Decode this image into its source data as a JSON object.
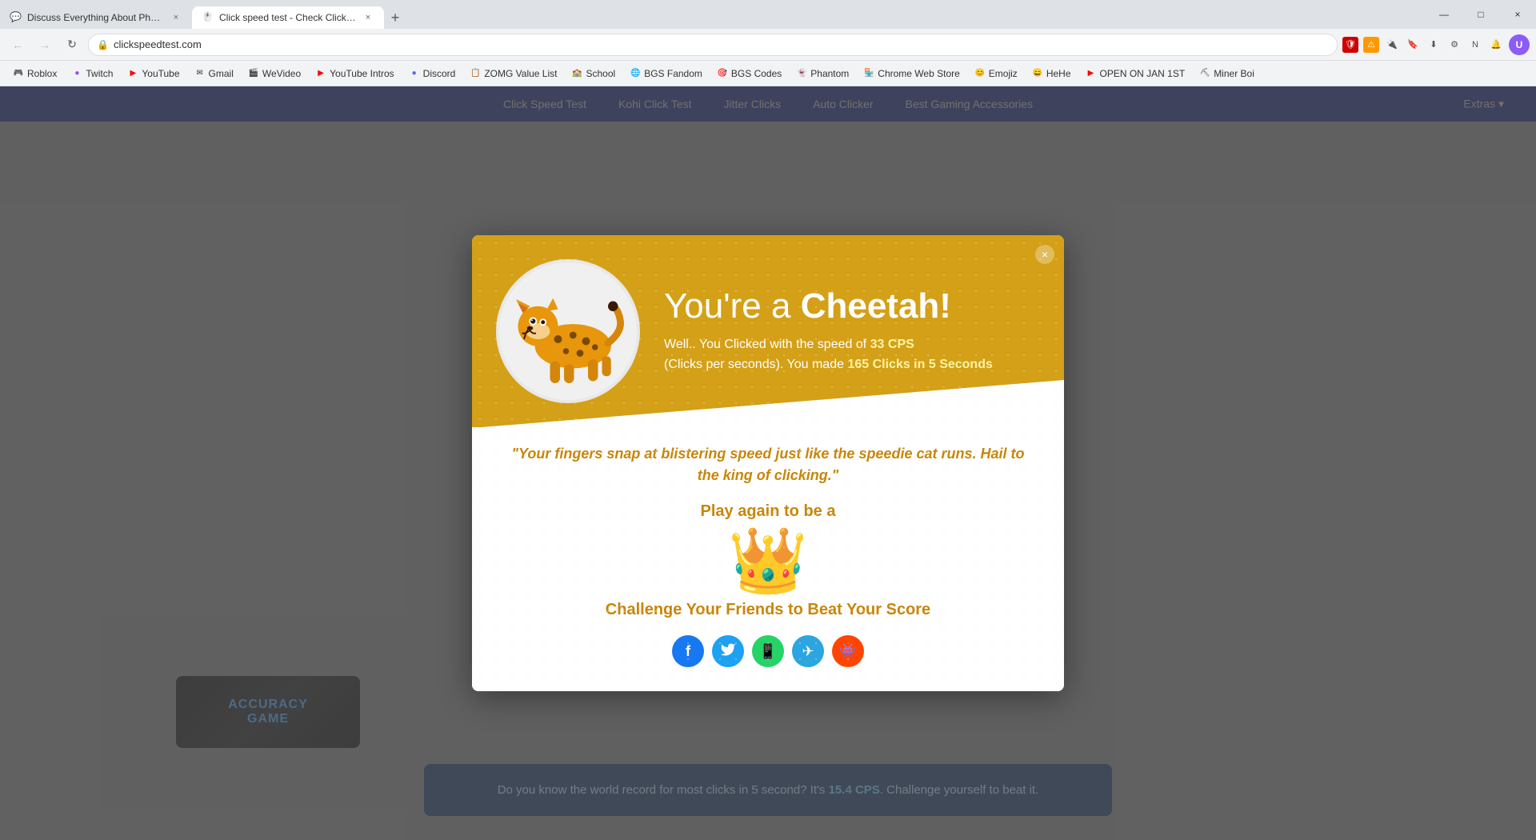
{
  "browser": {
    "tabs": [
      {
        "id": "tab-1",
        "title": "Discuss Everything About Phanto...",
        "favicon": "💬",
        "active": false
      },
      {
        "id": "tab-2",
        "title": "Click speed test - Check Clicks pe...",
        "favicon": "🖱️",
        "active": true
      }
    ],
    "url": "clickspeedtest.com",
    "new_tab_label": "+",
    "window_controls": {
      "minimize": "—",
      "maximize": "□",
      "close": "×"
    }
  },
  "bookmarks": [
    {
      "label": "Roblox",
      "favicon": "🎮"
    },
    {
      "label": "Twitch",
      "favicon": "💜"
    },
    {
      "label": "YouTube",
      "favicon": "▶"
    },
    {
      "label": "Gmail",
      "favicon": "✉"
    },
    {
      "label": "WeVideo",
      "favicon": "🎬"
    },
    {
      "label": "YouTube Intros",
      "favicon": "▶"
    },
    {
      "label": "Discord",
      "favicon": "💬"
    },
    {
      "label": "ZOMG Value List",
      "favicon": "📋"
    },
    {
      "label": "School",
      "favicon": "🏫"
    },
    {
      "label": "BGS Fandom",
      "favicon": "🌐"
    },
    {
      "label": "BGS Codes",
      "favicon": "🎯"
    },
    {
      "label": "Phantom",
      "favicon": "👻"
    },
    {
      "label": "Chrome Web Store",
      "favicon": "🏪"
    },
    {
      "label": "Emojiz",
      "favicon": "😊"
    },
    {
      "label": "HeHe",
      "favicon": "😄"
    },
    {
      "label": "OPEN ON JAN 1ST",
      "favicon": "📅"
    },
    {
      "label": "Miner Boi",
      "favicon": "⛏"
    }
  ],
  "site_nav": {
    "items": [
      "Click Speed Test",
      "Kohi Click Test",
      "Jitter Clicks",
      "Auto Clicker",
      "Best Gaming Accessories"
    ],
    "extras_label": "Extras ▾"
  },
  "modal": {
    "close_btn": "×",
    "animal": "Cheetah",
    "title": "You're a",
    "title_bold": "Cheetah!",
    "subtitle_prefix": "Well.. You Clicked with the speed of ",
    "cps": "33 CPS",
    "subtitle_suffix": "(Clicks per seconds). You made ",
    "clicks_highlight": "165 Clicks in 5 Seconds",
    "quote": "\"Your fingers snap at blistering speed just like the speedie cat runs. Hail to the king of clicking.\"",
    "play_again_text": "Play again to be a",
    "crown_emoji": "👑",
    "challenge_text": "Challenge Your Friends to Beat Your Score",
    "social_buttons": [
      {
        "name": "facebook",
        "label": "f",
        "color": "#1877f2"
      },
      {
        "name": "twitter",
        "label": "🐦",
        "color": "#1da1f2"
      },
      {
        "name": "whatsapp",
        "label": "📱",
        "color": "#25d366"
      },
      {
        "name": "telegram",
        "label": "✈",
        "color": "#2ca5e0"
      },
      {
        "name": "reddit",
        "label": "👾",
        "color": "#ff4500"
      }
    ]
  },
  "bottom_bar": {
    "text_prefix": "Do you know the world record for most clicks in 5 second? It's ",
    "record": "15.4 CPS",
    "text_suffix": ". Challenge yourself to beat it."
  },
  "left_card": {
    "line1": "ACCURACY",
    "line2": "GAME"
  }
}
